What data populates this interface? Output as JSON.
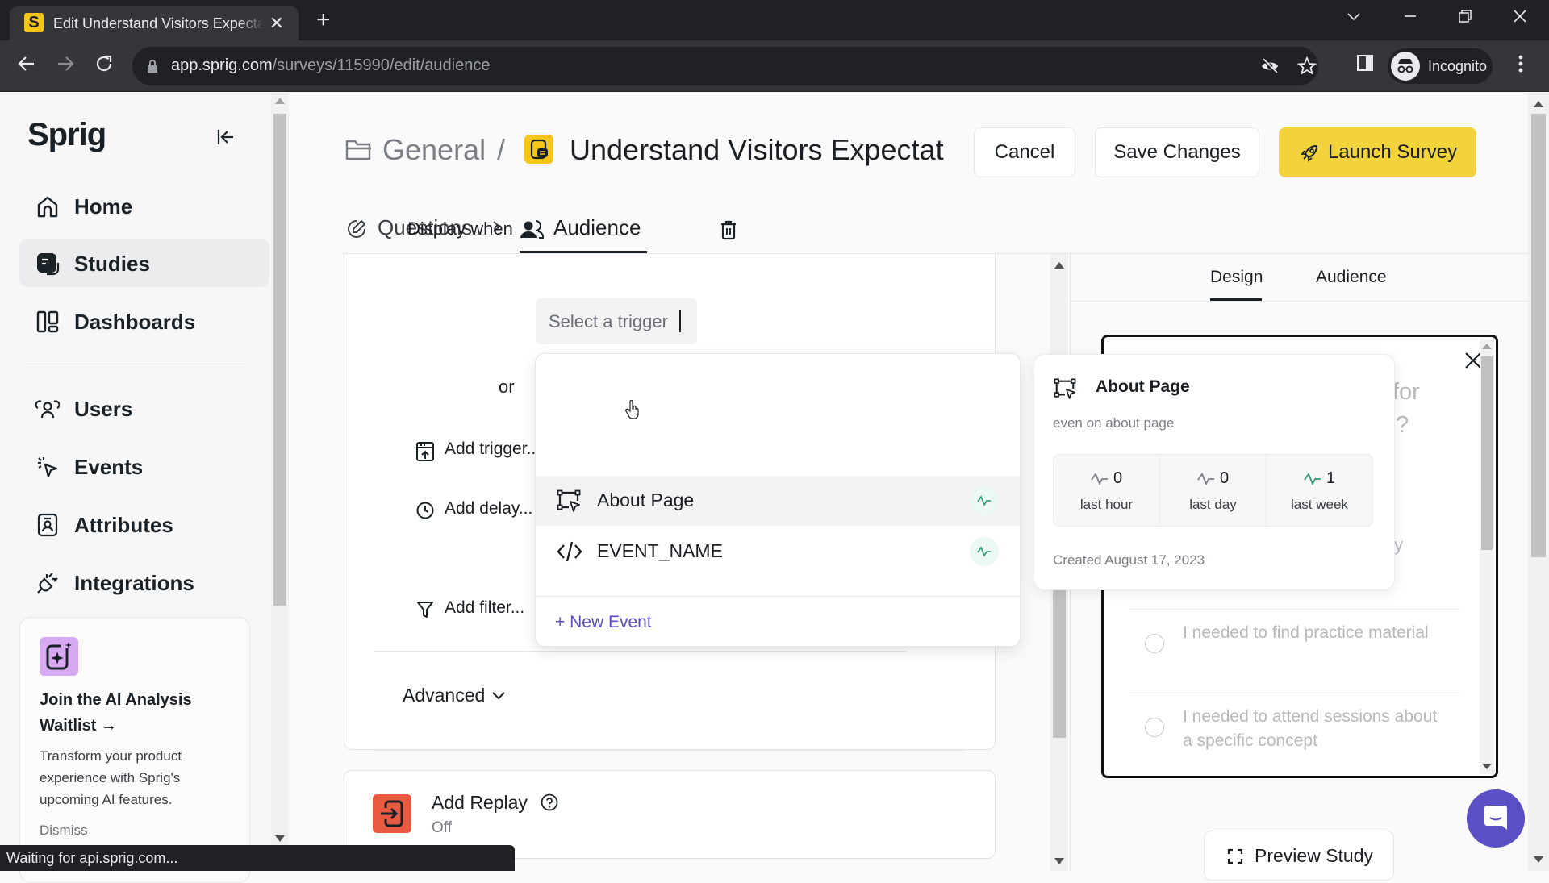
{
  "browser": {
    "tab_title": "Edit Understand Visitors Expectat",
    "tab_favicon_letter": "S",
    "url_host": "app.sprig.com",
    "url_path": "/surveys/115990/edit/audience",
    "profile_label": "Incognito",
    "status_text": "Waiting for api.sprig.com..."
  },
  "sidebar": {
    "logo": "Sprig",
    "items": [
      {
        "label": "Home",
        "icon": "home-icon",
        "active": false
      },
      {
        "label": "Studies",
        "icon": "studies-icon",
        "active": true
      },
      {
        "label": "Dashboards",
        "icon": "dashboards-icon",
        "active": false
      },
      {
        "label": "Users",
        "icon": "users-icon",
        "active": false
      },
      {
        "label": "Events",
        "icon": "events-icon",
        "active": false
      },
      {
        "label": "Attributes",
        "icon": "attributes-icon",
        "active": false
      },
      {
        "label": "Integrations",
        "icon": "integrations-icon",
        "active": false
      }
    ],
    "promo": {
      "title": "Join the AI Analysis Waitlist →",
      "description": "Transform your product experience with Sprig's upcoming AI features.",
      "dismiss": "Dismiss"
    }
  },
  "header": {
    "breadcrumb_folder": "General",
    "breadcrumb_separator": "/",
    "study_title": "Understand Visitors Expectat",
    "cancel_label": "Cancel",
    "save_label": "Save Changes",
    "launch_label": "Launch Survey",
    "launch_color": "#f2d33b",
    "steps": [
      {
        "label": "Questions",
        "active": false
      },
      {
        "label": "Audience",
        "active": true
      }
    ],
    "step_separator": "›"
  },
  "audience": {
    "display_when_label": "Display when",
    "trigger_placeholder": "Select a trigger",
    "or_label": "or",
    "add_trigger": "Add trigger...",
    "add_delay": "Add delay...",
    "add_filter": "Add filter...",
    "advanced": "Advanced",
    "replay": {
      "title": "Add Replay",
      "status": "Off"
    }
  },
  "trigger_dropdown": {
    "items": [
      {
        "label": "About Page",
        "type": "page-url-event",
        "hovered": true
      },
      {
        "label": "EVENT_NAME",
        "type": "code-event",
        "hovered": false
      }
    ],
    "new_event_label": "+ New Event",
    "accent_color": "#5b4fc4"
  },
  "event_popover": {
    "title": "About Page",
    "description": "even on about page",
    "stats": [
      {
        "value": "0",
        "label": "last hour",
        "active": false
      },
      {
        "value": "0",
        "label": "last day",
        "active": false
      },
      {
        "value": "1",
        "label": "last week",
        "active": true
      }
    ],
    "created": "Created August 17, 2023",
    "active_color": "#2e9a74"
  },
  "preview": {
    "tabs": [
      {
        "label": "Design",
        "active": true
      },
      {
        "label": "Audience",
        "active": false
      }
    ],
    "question_fragments": [
      "for",
      "?",
      "y"
    ],
    "options": [
      "I needed to find practice material",
      "I needed to attend sessions about a specific concept"
    ],
    "preview_button": "Preview Study"
  }
}
